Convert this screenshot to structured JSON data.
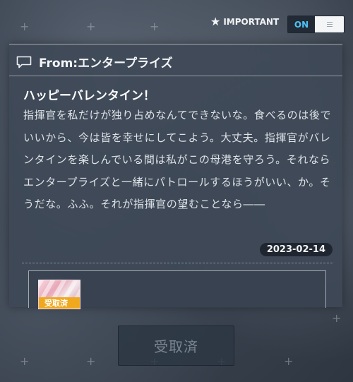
{
  "header": {
    "important_label": "IMPORTANT",
    "toggle_on_label": "ON"
  },
  "mail": {
    "from_label": "From:",
    "sender": "エンタープライズ",
    "subject": "ハッピーバレンタイン！",
    "body": "指揮官を私だけが独り占めなんてできないな。食べるのは後でいいから、今は皆を幸せにしてこよう。大丈夫。指揮官がバレンタインを楽しんでいる間は私がこの母港を守ろう。それならエンタープライズと一緒にパトロールするほうがいい、か。そうだな。ふふ。それが指揮官の望むことなら――",
    "date": "2023-02-14"
  },
  "attachment": {
    "status_badge": "受取済"
  },
  "footer": {
    "claim_button_label": "受取済"
  },
  "colors": {
    "accent_on": "#4fc3f7",
    "badge_orange": "#f0a81e"
  },
  "icons": [
    "star-icon",
    "menu-icon",
    "chat-icon"
  ]
}
